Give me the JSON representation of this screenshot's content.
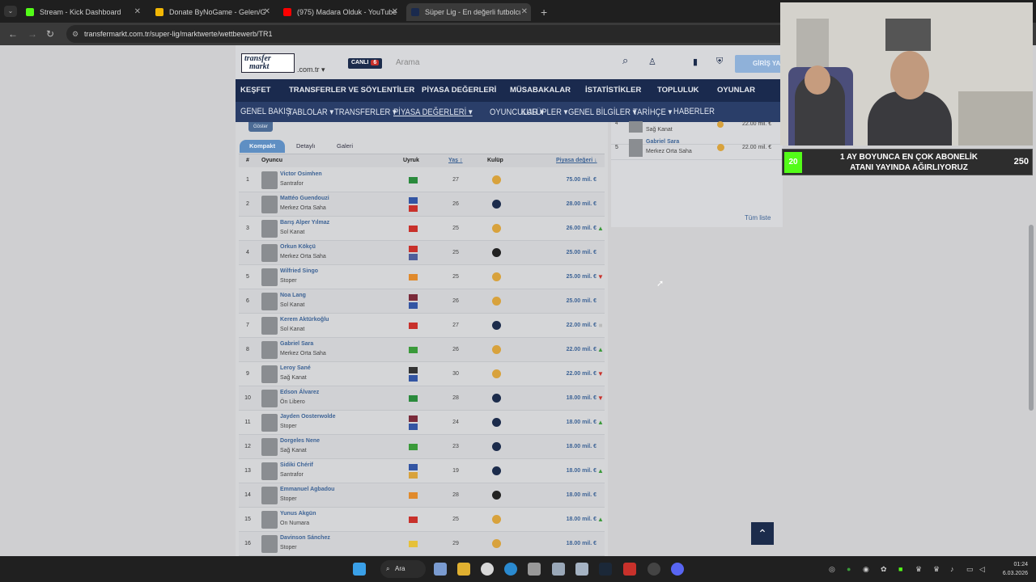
{
  "browser": {
    "tabs": [
      {
        "title": "Stream - Kick Dashboard",
        "color": "#53fc18"
      },
      {
        "title": "Donate ByNoGame - Gelen/Giden",
        "color": "#f2b705"
      },
      {
        "title": "(975) Madara Olduk - YouTube",
        "color": "#ff0000"
      },
      {
        "title": "Süper Lig - En değerli futbolcular",
        "color": "#1a2a4e"
      }
    ],
    "url": "transfermarkt.com.tr/super-lig/marktwerte/wettbewerb/TR1"
  },
  "site": {
    "logo_line1": "transfer",
    "logo_line2": "markt",
    "logo_sub": ".com.tr ▾",
    "live_label": "CANLI",
    "live_count": "6",
    "search_placeholder": "Arama",
    "login": "GİRİŞ YAP",
    "nav_main": [
      "KEŞFET",
      "TRANSFERLER VE SÖYLENTİLER",
      "PİYASA DEĞERLERİ",
      "MÜSABAKALAR",
      "İSTATİSTİKLER",
      "TOPLULUK",
      "OYUNLAR"
    ],
    "nav_sub": [
      "GENEL BAKIŞ",
      "TABLOLAR ▾",
      "TRANSFERLER ▾",
      "PİYASA DEĞERLERİ ▾",
      "OYUNCULAR ▾",
      "KULÜPLER ▾",
      "GENEL BİLGİLER ▾",
      "TARİHÇE ▾",
      "HABERLER"
    ]
  },
  "table": {
    "show_button": "Göster",
    "view_tabs": [
      "Kompakt",
      "Detaylı",
      "Galeri"
    ],
    "headers": {
      "no": "#",
      "player": "Oyuncu",
      "nationality": "Uyruk",
      "age": "Yaş ↕",
      "club": "Kulüp",
      "value": "Piyasa değeri ↓"
    },
    "rows": [
      {
        "no": "1",
        "name": "Victor Osimhen",
        "pos": "Santrafor",
        "flags": [
          "#2a8a3c"
        ],
        "age": "27",
        "club": "#d8a23c",
        "value": "75.00 mil. €",
        "trend": ""
      },
      {
        "no": "2",
        "name": "Mattéo Guendouzi",
        "pos": "Merkez Orta Saha",
        "flags": [
          "#3355a3",
          "#c8312b"
        ],
        "age": "26",
        "club": "#1c2c4c",
        "value": "28.00 mil. €",
        "trend": ""
      },
      {
        "no": "3",
        "name": "Barış Alper Yılmaz",
        "pos": "Sol Kanat",
        "flags": [
          "#c8312b"
        ],
        "age": "25",
        "club": "#d8a23c",
        "value": "26.00 mil. €",
        "trend": "up"
      },
      {
        "no": "4",
        "name": "Orkun Kökçü",
        "pos": "Merkez Orta Saha",
        "flags": [
          "#c8312b",
          "#4f5e9a"
        ],
        "age": "25",
        "club": "#222222",
        "value": "25.00 mil. €",
        "trend": ""
      },
      {
        "no": "5",
        "name": "Wilfried Singo",
        "pos": "Stoper",
        "flags": [
          "#e08a2c"
        ],
        "age": "25",
        "club": "#d8a23c",
        "value": "25.00 mil. €",
        "trend": "down"
      },
      {
        "no": "6",
        "name": "Noa Lang",
        "pos": "Sol Kanat",
        "flags": [
          "#7a2a3a",
          "#3355a3"
        ],
        "age": "26",
        "club": "#d8a23c",
        "value": "25.00 mil. €",
        "trend": ""
      },
      {
        "no": "7",
        "name": "Kerem Aktürkoğlu",
        "pos": "Sol Kanat",
        "flags": [
          "#c8312b"
        ],
        "age": "27",
        "club": "#1c2c4c",
        "value": "22.00 mil. €",
        "trend": "flat"
      },
      {
        "no": "8",
        "name": "Gabriel Sara",
        "pos": "Merkez Orta Saha",
        "flags": [
          "#3a9a3a"
        ],
        "age": "26",
        "club": "#d8a23c",
        "value": "22.00 mil. €",
        "trend": "up"
      },
      {
        "no": "9",
        "name": "Leroy Sané",
        "pos": "Sağ Kanat",
        "flags": [
          "#333333",
          "#3355a3"
        ],
        "age": "30",
        "club": "#d8a23c",
        "value": "22.00 mil. €",
        "trend": "down"
      },
      {
        "no": "10",
        "name": "Edson Álvarez",
        "pos": "Ön Libero",
        "flags": [
          "#2a8a3c"
        ],
        "age": "28",
        "club": "#1c2c4c",
        "value": "18.00 mil. €",
        "trend": "down"
      },
      {
        "no": "11",
        "name": "Jayden Oosterwolde",
        "pos": "Stoper",
        "flags": [
          "#7a2a3a",
          "#3355a3"
        ],
        "age": "24",
        "club": "#1c2c4c",
        "value": "18.00 mil. €",
        "trend": "up"
      },
      {
        "no": "12",
        "name": "Dorgeles Nene",
        "pos": "Sağ Kanat",
        "flags": [
          "#3a9a3a"
        ],
        "age": "23",
        "club": "#1c2c4c",
        "value": "18.00 mil. €",
        "trend": ""
      },
      {
        "no": "13",
        "name": "Sidiki Chérif",
        "pos": "Santrafor",
        "flags": [
          "#3355a3",
          "#d8a23c"
        ],
        "age": "19",
        "club": "#1c2c4c",
        "value": "18.00 mil. €",
        "trend": "up"
      },
      {
        "no": "14",
        "name": "Emmanuel Agbadou",
        "pos": "Stoper",
        "flags": [
          "#e08a2c"
        ],
        "age": "28",
        "club": "#222222",
        "value": "18.00 mil. €",
        "trend": ""
      },
      {
        "no": "15",
        "name": "Yunus Akgün",
        "pos": "On Numara",
        "flags": [
          "#c8312b"
        ],
        "age": "25",
        "club": "#d8a23c",
        "value": "18.00 mil. €",
        "trend": "up"
      },
      {
        "no": "16",
        "name": "Davinson Sánchez",
        "pos": "Stoper",
        "flags": [
          "#e6c13a"
        ],
        "age": "29",
        "club": "#d8a23c",
        "value": "18.00 mil. €",
        "trend": ""
      }
    ]
  },
  "sidebar": {
    "rows": [
      {
        "no": "4",
        "name": "",
        "pos": "Sağ Kanat",
        "value": "22.00 mil. €"
      },
      {
        "no": "5",
        "name": "Gabriel Sara",
        "pos": "Merkez Orta Saha",
        "value": "22.00 mil. €"
      }
    ],
    "all_list": "Tüm liste"
  },
  "overlay": {
    "sub_count": "20",
    "banner_line1": "1 AY BOYUNCA EN ÇOK ABONELİK",
    "banner_line2": "ATANI YAYINDA AĞIRLIYORUZ",
    "goal": "250"
  },
  "taskbar": {
    "search": "Ara",
    "time": "01:24",
    "date": "6.03.2026"
  }
}
